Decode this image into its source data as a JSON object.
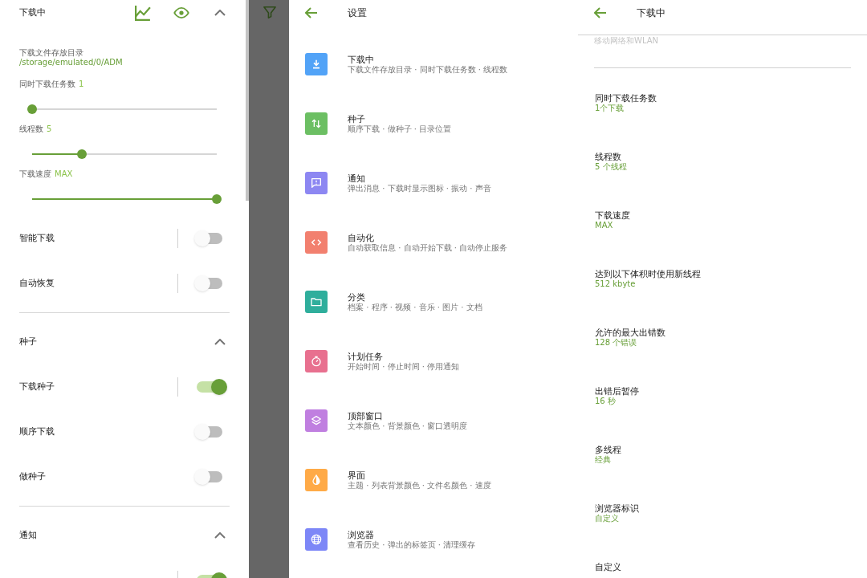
{
  "drawer": {
    "sections": [
      {
        "kind": "tools",
        "title": "下载中",
        "expanded": true,
        "items": [
          {
            "kind": "path",
            "label": "下载文件存放目录",
            "value": "/storage/emulated/0/ADM"
          },
          {
            "kind": "slider",
            "label": "同时下载任务数",
            "value": "1",
            "level": 0
          },
          {
            "kind": "slider",
            "label": "线程数",
            "value": "5",
            "level": 0.27
          },
          {
            "kind": "slider",
            "label": "下载速度",
            "value": "MAX",
            "level": 1
          },
          {
            "kind": "switch",
            "label": "智能下载",
            "on": false,
            "separator": true
          },
          {
            "kind": "switch",
            "label": "自动恢复",
            "on": false,
            "separator": true
          }
        ]
      },
      {
        "kind": "plain",
        "title": "种子",
        "expanded": true,
        "items": [
          {
            "kind": "switch",
            "label": "下载种子",
            "on": true,
            "separator": true
          },
          {
            "kind": "switch",
            "label": "顺序下载",
            "on": false,
            "separator": false
          },
          {
            "kind": "switch",
            "label": "做种子",
            "on": false,
            "separator": false
          }
        ]
      },
      {
        "kind": "plain",
        "title": "通知",
        "expanded": true,
        "items": [
          {
            "kind": "switch",
            "on": true,
            "separator": true
          }
        ]
      }
    ]
  },
  "settings": {
    "title": "设置",
    "items": [
      {
        "title": "下载中",
        "subtitle": "下载文件存放目录 · 同时下载任务数 · 线程数",
        "color": "#52a3f7"
      },
      {
        "title": "种子",
        "subtitle": "顺序下载 · 做种子 · 目录位置",
        "color": "#6cbf63"
      },
      {
        "title": "通知",
        "subtitle": "弹出消息 · 下载时显示图标 · 振动 · 声音",
        "color": "#8d87f2"
      },
      {
        "title": "自动化",
        "subtitle": "自动获取信息 · 自动开始下载 · 自动停止服务",
        "color": "#f2806f"
      },
      {
        "title": "分类",
        "subtitle": "档案 · 程序 · 视频 · 音乐 · 图片 · 文档",
        "color": "#2fae9c"
      },
      {
        "title": "计划任务",
        "subtitle": "开始时间 · 停止时间 · 停用通知",
        "color": "#e8708f"
      },
      {
        "title": "顶部窗口",
        "subtitle": "文本颜色 · 背景颜色 · 窗口透明度",
        "color": "#c07fe0"
      },
      {
        "title": "界面",
        "subtitle": "主题 · 列表背景颜色 · 文件名颜色 · 速度",
        "color": "#ffaa47"
      },
      {
        "title": "浏览器",
        "subtitle": "查看历史 · 弹出的标签页 · 清理缓存",
        "color": "#7d87f7"
      }
    ]
  },
  "download_settings": {
    "title": "下载中",
    "clipped_subtitle": "移动网络和WLAN",
    "items": [
      {
        "title": "同时下载任务数",
        "value": "1个下载"
      },
      {
        "title": "线程数",
        "value": "5 个线程"
      },
      {
        "title": "下载速度",
        "value": "MAX"
      },
      {
        "title": "达到以下体积时使用新线程",
        "value": "512 kbyte"
      },
      {
        "title": "允许的最大出错数",
        "value": "128 个错误"
      },
      {
        "title": "出错后暂停",
        "value": "16 秒"
      },
      {
        "title": "多线程",
        "value": "经典"
      },
      {
        "title": "浏览器标识",
        "value": "自定义"
      },
      {
        "title": "自定义"
      }
    ]
  }
}
